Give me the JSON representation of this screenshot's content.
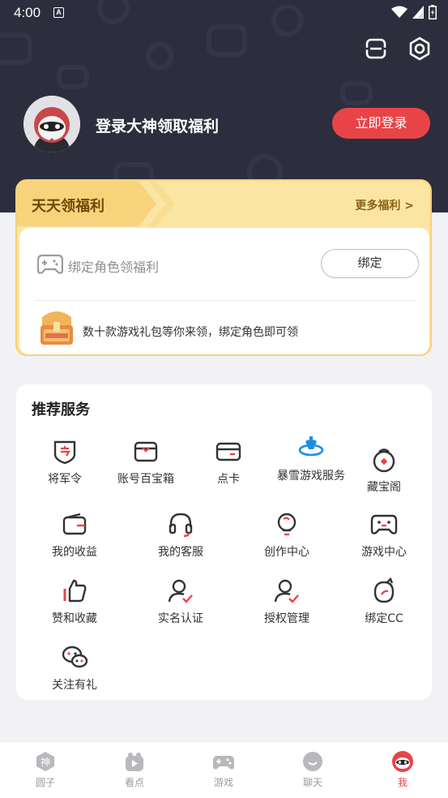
{
  "status_bar": {
    "time": "4:00",
    "notification_badge": "A"
  },
  "profile": {
    "login_title": "登录大神领取福利",
    "login_button": "立即登录"
  },
  "welfare": {
    "title": "天天领福利",
    "more_link": "更多福利 >",
    "bind_label": "绑定角色领福利",
    "bind_button": "绑定",
    "gift_text": "数十款游戏礼包等你来领，绑定角色即可领"
  },
  "services": {
    "title": "推荐服务",
    "items": [
      {
        "label": "将军令",
        "icon": "shield-token-icon"
      },
      {
        "label": "账号百宝箱",
        "icon": "treasure-box-icon"
      },
      {
        "label": "点卡",
        "icon": "card-icon"
      },
      {
        "label": "暴雪游戏服务",
        "icon": "blizzard-icon"
      },
      {
        "label": "藏宝阁",
        "icon": "treasure-pavilion-icon"
      },
      {
        "label": "我的收益",
        "icon": "wallet-icon"
      },
      {
        "label": "我的客服",
        "icon": "headset-icon"
      },
      {
        "label": "创作中心",
        "icon": "lightbulb-icon"
      },
      {
        "label": "游戏中心",
        "icon": "gamepad-icon"
      },
      {
        "label": "赞和收藏",
        "icon": "thumbs-up-icon"
      },
      {
        "label": "实名认证",
        "icon": "user-verify-icon"
      },
      {
        "label": "授权管理",
        "icon": "user-authorize-icon"
      },
      {
        "label": "绑定CC",
        "icon": "cc-bind-icon"
      },
      {
        "label": "关注有礼",
        "icon": "chat-bubbles-icon"
      }
    ]
  },
  "tabbar": {
    "tabs": [
      {
        "label": "圆子",
        "icon": "shen-icon"
      },
      {
        "label": "看点",
        "icon": "video-icon"
      },
      {
        "label": "游戏",
        "icon": "gamepad-icon"
      },
      {
        "label": "聊天",
        "icon": "chat-icon"
      },
      {
        "label": "我",
        "icon": "me-avatar-icon"
      }
    ],
    "active_index": 4
  },
  "colors": {
    "header_bg": "#2d2e3d",
    "accent_red": "#e84448",
    "welfare_bg": "#fbe5a3",
    "page_bg": "#f2f2f4"
  }
}
